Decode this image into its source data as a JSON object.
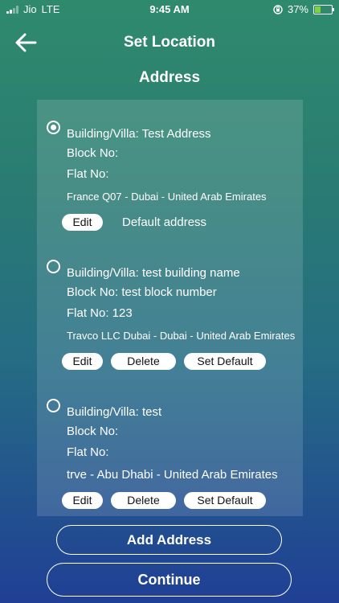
{
  "status_bar": {
    "carrier": "Jio",
    "network": "LTE",
    "time": "9:45 AM",
    "battery": "37%",
    "battery_level": 0.37
  },
  "header": {
    "title": "Set Location",
    "subtitle": "Address"
  },
  "addresses": [
    {
      "selected": true,
      "building": "Building/Villa: Test Address",
      "block": "Block No:",
      "flat": "Flat No:",
      "location": "France Q07 - Dubai - United Arab Emirates",
      "edit_label": "Edit",
      "default_label": "Default address"
    },
    {
      "selected": false,
      "building": "Building/Villa: test building name",
      "block": "Block No: test block number",
      "flat": "Flat No: 123",
      "location": "Travco LLC Dubai - Dubai - United Arab Emirates",
      "edit_label": "Edit",
      "delete_label": "Delete",
      "set_default_label": "Set Default"
    },
    {
      "selected": false,
      "building": "Building/Villa: test",
      "block": "Block No:",
      "flat": "Flat No:",
      "location": "trve - Abu Dhabi - United Arab Emirates",
      "edit_label": "Edit",
      "delete_label": "Delete",
      "set_default_label": "Set Default"
    }
  ],
  "actions": {
    "add_address": "Add Address",
    "continue": "Continue"
  },
  "icons": {
    "back": "back-arrow-icon",
    "signal": "signal-bars-icon",
    "lock": "orientation-lock-icon",
    "battery": "battery-icon"
  }
}
